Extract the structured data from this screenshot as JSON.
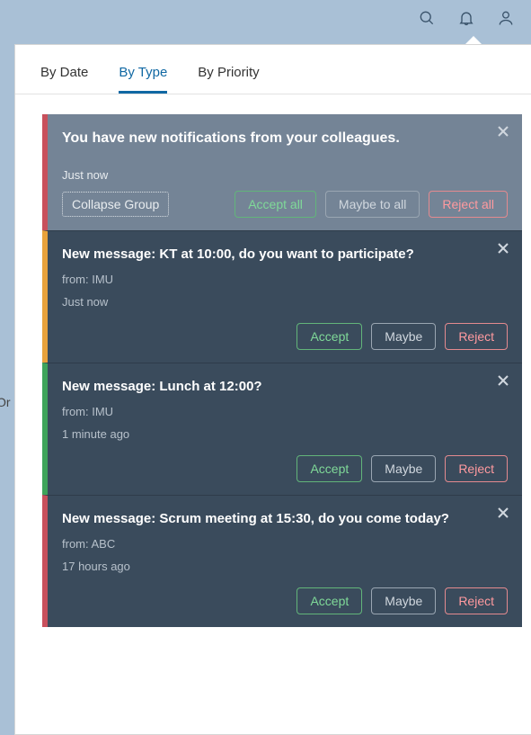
{
  "topbar": {
    "icons": [
      "search",
      "bell",
      "user"
    ]
  },
  "background_fragments": [
    "Or",
    ")"
  ],
  "tabs": [
    {
      "label": "By Date",
      "active": false
    },
    {
      "label": "By Type",
      "active": true
    },
    {
      "label": "By Priority",
      "active": false
    }
  ],
  "group": {
    "title": "You have new notifications from your colleagues.",
    "time": "Just now",
    "accent_color": "#c8505c",
    "collapse_label": "Collapse Group",
    "accept_all": "Accept all",
    "maybe_all": "Maybe to all",
    "reject_all": "Reject all"
  },
  "notifications": [
    {
      "title": "New message: KT at 10:00, do you want to participate?",
      "from": "from: IMU",
      "time": "Just now",
      "accent": "orange",
      "accept": "Accept",
      "maybe": "Maybe",
      "reject": "Reject"
    },
    {
      "title": "New message: Lunch at 12:00?",
      "from": "from: IMU",
      "time": "1 minute ago",
      "accent": "green",
      "accept": "Accept",
      "maybe": "Maybe",
      "reject": "Reject"
    },
    {
      "title": "New message: Scrum meeting at 15:30, do you come today?",
      "from": "from: ABC",
      "time": "17 hours ago",
      "accent": "red",
      "accept": "Accept",
      "maybe": "Maybe",
      "reject": "Reject"
    }
  ]
}
